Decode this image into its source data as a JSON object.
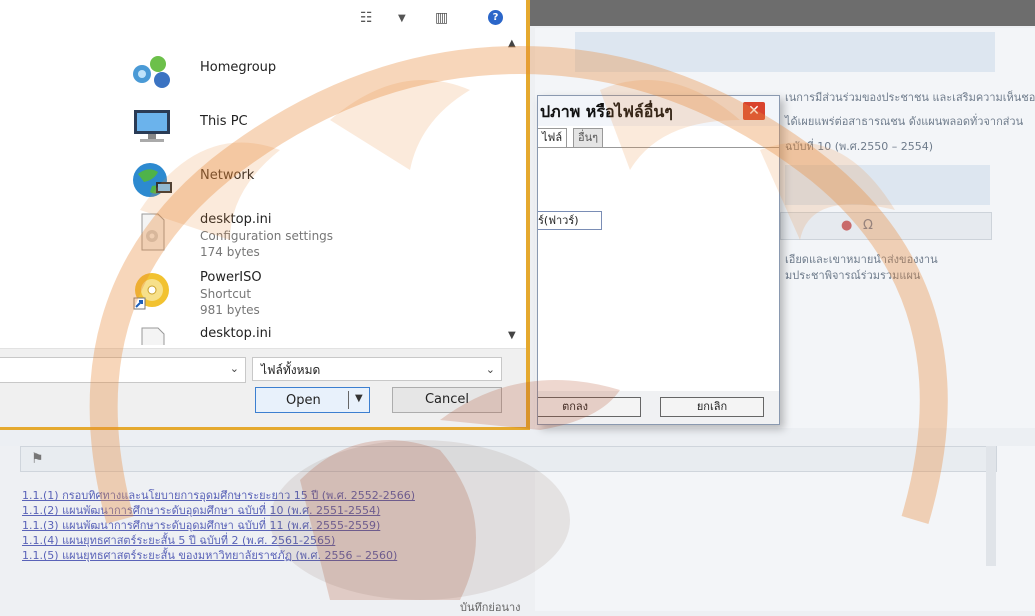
{
  "file_dialog": {
    "nav_items": [
      {
        "label": "Homegroup",
        "icon": "homegroup-icon"
      },
      {
        "label": "This PC",
        "icon": "computer-icon"
      },
      {
        "label": "Network",
        "icon": "network-icon"
      }
    ],
    "files": [
      {
        "name": "desktop.ini",
        "type": "Configuration settings",
        "size": "174 bytes",
        "icon": "ini-file-icon"
      },
      {
        "name": "PowerISO",
        "type": "Shortcut",
        "size": "981 bytes",
        "icon": "poweriso-icon"
      },
      {
        "name": "desktop.ini",
        "type": "",
        "size": "",
        "icon": "ini-file-icon"
      }
    ],
    "file_type": "ไฟล์ทั้งหมด",
    "open_label": "Open",
    "cancel_label": "Cancel"
  },
  "image_dialog": {
    "title": "ปภาพ หรือไฟล์อื่นๆ",
    "tab1": "ไฟล์",
    "tab2": "อื่นๆ",
    "field_value": "ร์(ฟาวร์)",
    "ok_label": "ตกลง",
    "cancel_label": "ยกเลิก"
  },
  "background": {
    "text1": "เนการมีส่วนร่วมของประชาชน และเสริมความเห็นชอบจาก",
    "text2": "ได้เผยแพร่ต่อสาธารณชน ดังแผนพลอดทั่วจากส่วน",
    "text3": "ฉบับที่ 10 (พ.ศ.2550 – 2554)",
    "text4": "เอียดและเขาหมายนำส่งของงาน",
    "text5": "มประชาพิจารณ์ร่วมรวมแผน",
    "links": [
      "1.1.(1) กรอบทิศทางและนโยบายการอุดมศึกษาระยะยาว 15 ปี (พ.ศ. 2552-2566)",
      "1.1.(2) แผนพัฒนาการศึกษาระดับอุดมศึกษา ฉบับที่ 10 (พ.ศ. 2551-2554)",
      "1.1.(3) แผนพัฒนาการศึกษาระดับอุดมศึกษา ฉบับที่ 11 (พ.ศ. 2555-2559)",
      "1.1.(4) แผนยุทธศาสตร์ระยะสั้น 5 ปี ฉบับที่ 2 (พ.ศ. 2561-2565)",
      "1.1.(5) แผนยุทธศาสตร์ระยะสั้น ของมหาวิทยาลัยราชภัฏ (พ.ศ. 2556 – 2560)"
    ],
    "footer": "บันทึกย่อนาง"
  }
}
